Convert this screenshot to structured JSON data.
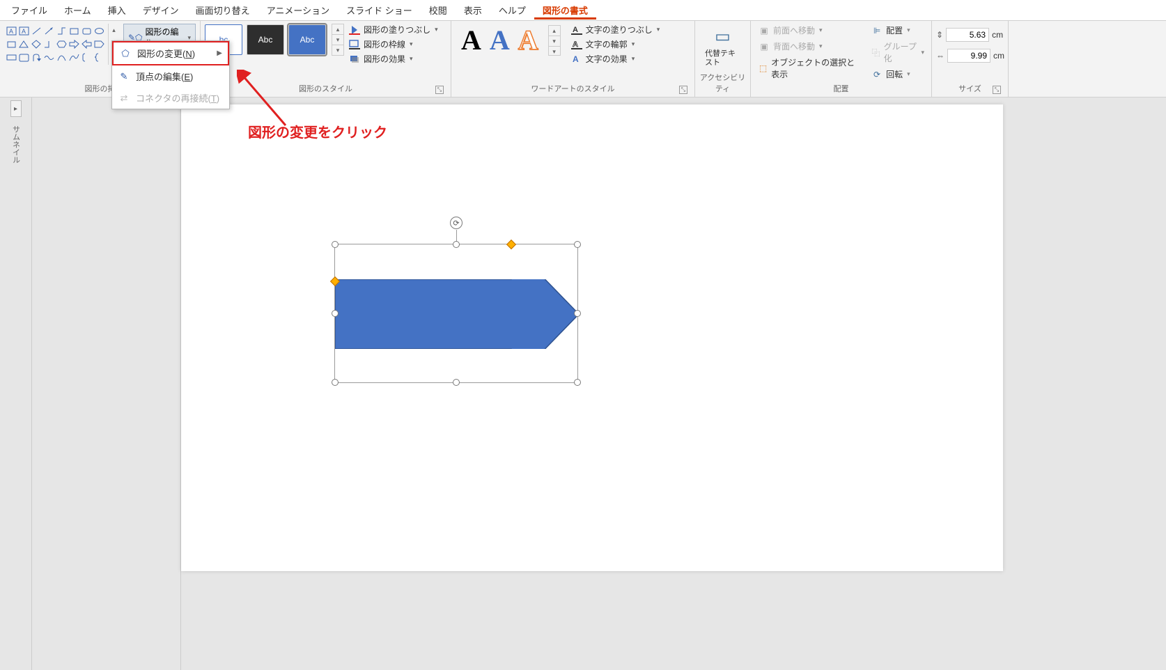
{
  "menu": {
    "file": "ファイル",
    "home": "ホーム",
    "insert": "挿入",
    "design": "デザイン",
    "transition": "画面切り替え",
    "animation": "アニメーション",
    "slideshow": "スライド ショー",
    "review": "校閲",
    "view": "表示",
    "help": "ヘルプ",
    "shapeformat": "図形の書式"
  },
  "ribbon": {
    "editShape": "図形の編集",
    "dd_changeShape": "図形の変更(N)",
    "dd_editPoints": "頂点の編集(E)",
    "dd_reconnect": "コネクタの再接続(T)",
    "abc": "Abc",
    "bc": "bc",
    "shapeFill": "図形の塗りつぶし",
    "shapeOutline": "図形の枠線",
    "shapeEffects": "図形の効果",
    "textFill": "文字の塗りつぶし",
    "textOutline": "文字の輪郭",
    "textEffects": "文字の効果",
    "altText": "代替テキスト",
    "bringFwd": "前面へ移動",
    "sendBack": "背面へ移動",
    "selPane": "オブジェクトの選択と表示",
    "align": "配置",
    "group": "グループ化",
    "rotate": "回転",
    "grp_insertShape": "図形の挿",
    "grp_shapeStyle": "図形のスタイル",
    "grp_wordArt": "ワードアートのスタイル",
    "grp_acc": "アクセシビリティ",
    "grp_arrange": "配置",
    "grp_size": "サイズ",
    "wa": "A"
  },
  "size": {
    "h": "5.63",
    "w": "9.99",
    "unit": "cm"
  },
  "thumb": {
    "label": "サムネイル"
  },
  "annotation": {
    "text": "図形の変更をクリック"
  }
}
